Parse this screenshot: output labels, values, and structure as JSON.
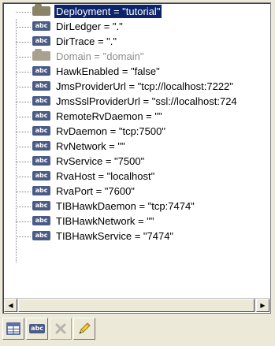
{
  "tree": {
    "root": {
      "label": "Deployment = \"tutorial\"",
      "icon": "folder-icon",
      "selected": true
    },
    "items": [
      {
        "label": "DirLedger = \".\"",
        "icon": "string-attribute-icon",
        "icon_text": "abc"
      },
      {
        "label": "DirTrace = \".\"",
        "icon": "string-attribute-icon",
        "icon_text": "abc"
      },
      {
        "label": "Domain = \"domain\"",
        "icon": "folder-icon",
        "disabled": true
      },
      {
        "label": "HawkEnabled = \"false\"",
        "icon": "string-attribute-icon",
        "icon_text": "abc"
      },
      {
        "label": "JmsProviderUrl = \"tcp://localhost:7222\"",
        "icon": "string-attribute-icon",
        "icon_text": "abc"
      },
      {
        "label": "JmsSslProviderUrl = \"ssl://localhost:724",
        "icon": "string-attribute-icon",
        "icon_text": "abc"
      },
      {
        "label": "RemoteRvDaemon = \"\"",
        "icon": "string-attribute-icon",
        "icon_text": "abc"
      },
      {
        "label": "RvDaemon = \"tcp:7500\"",
        "icon": "string-attribute-icon",
        "icon_text": "abc"
      },
      {
        "label": "RvNetwork = \"\"",
        "icon": "string-attribute-icon",
        "icon_text": "abc"
      },
      {
        "label": "RvService = \"7500\"",
        "icon": "string-attribute-icon",
        "icon_text": "abc"
      },
      {
        "label": "RvaHost = \"localhost\"",
        "icon": "string-attribute-icon",
        "icon_text": "abc"
      },
      {
        "label": "RvaPort = \"7600\"",
        "icon": "string-attribute-icon",
        "icon_text": "abc"
      },
      {
        "label": "TIBHawkDaemon = \"tcp:7474\"",
        "icon": "string-attribute-icon",
        "icon_text": "abc"
      },
      {
        "label": "TIBHawkNetwork = \"\"",
        "icon": "string-attribute-icon",
        "icon_text": "abc"
      },
      {
        "label": "TIBHawkService = \"7474\"",
        "icon": "string-attribute-icon",
        "icon_text": "abc"
      }
    ]
  },
  "scrollbar": {
    "left_arrow": "◀",
    "right_arrow": "▶"
  },
  "toolbar": {
    "buttons": [
      {
        "name": "add-table-button",
        "icon": "table-icon",
        "enabled": true
      },
      {
        "name": "add-string-button",
        "icon": "string-attribute-icon",
        "icon_text": "abc",
        "enabled": true
      },
      {
        "name": "delete-button",
        "icon": "delete-icon",
        "enabled": false
      },
      {
        "name": "edit-button",
        "icon": "pencil-icon",
        "enabled": true
      }
    ]
  },
  "colors": {
    "selection": "#0b246b",
    "string_icon": "#4a5b86",
    "folder_icon": "#8a8367",
    "disabled_text": "#8c8c8c"
  }
}
